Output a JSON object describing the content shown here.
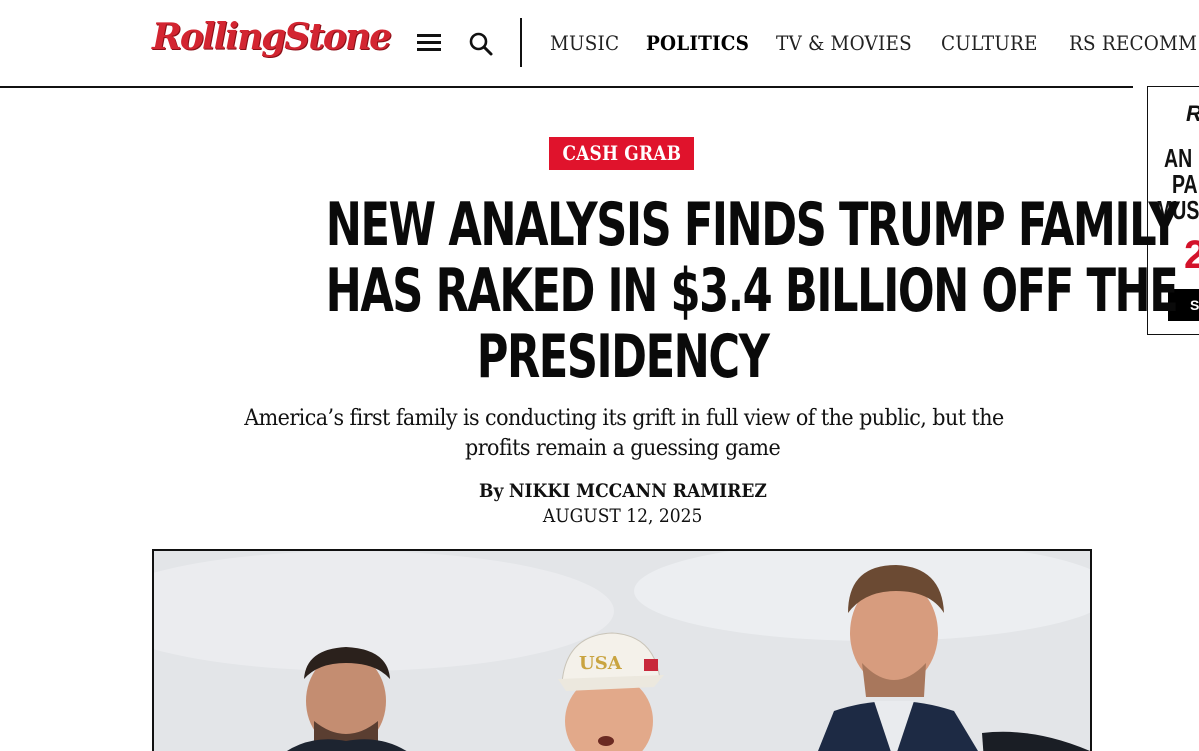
{
  "site": {
    "logo_text": "RollingStone",
    "brand_color": "#d32531"
  },
  "header": {
    "menu_icon": "hamburger-menu-icon",
    "search_icon": "search-icon",
    "nav": [
      {
        "label": "MUSIC",
        "active": false
      },
      {
        "label": "POLITICS",
        "active": true
      },
      {
        "label": "TV & MOVIES",
        "active": false
      },
      {
        "label": "CULTURE",
        "active": false
      },
      {
        "label": "RS RECOMM",
        "active": false
      }
    ]
  },
  "side_ad": {
    "logo": "R",
    "line1": "AN",
    "line2": "PA",
    "line3": "MUS",
    "number": "2",
    "button": "S"
  },
  "article": {
    "tag": "CASH GRAB",
    "tag_color": "#e0132c",
    "headline_lines": [
      "NEW ANALYSIS FINDS TRUMP FAMILY",
      "HAS RAKED IN $3.4 BILLION OFF THE",
      "PRESIDENCY"
    ],
    "dek_lines": [
      "America’s first family is conducting its grift in full view of the public, but the",
      "profits remain a guessing game"
    ],
    "byline_prefix": "By",
    "author": "NIKKI MCCANN RAMIREZ",
    "date": "AUGUST 12, 2025",
    "hero_cap_text": "USA"
  }
}
